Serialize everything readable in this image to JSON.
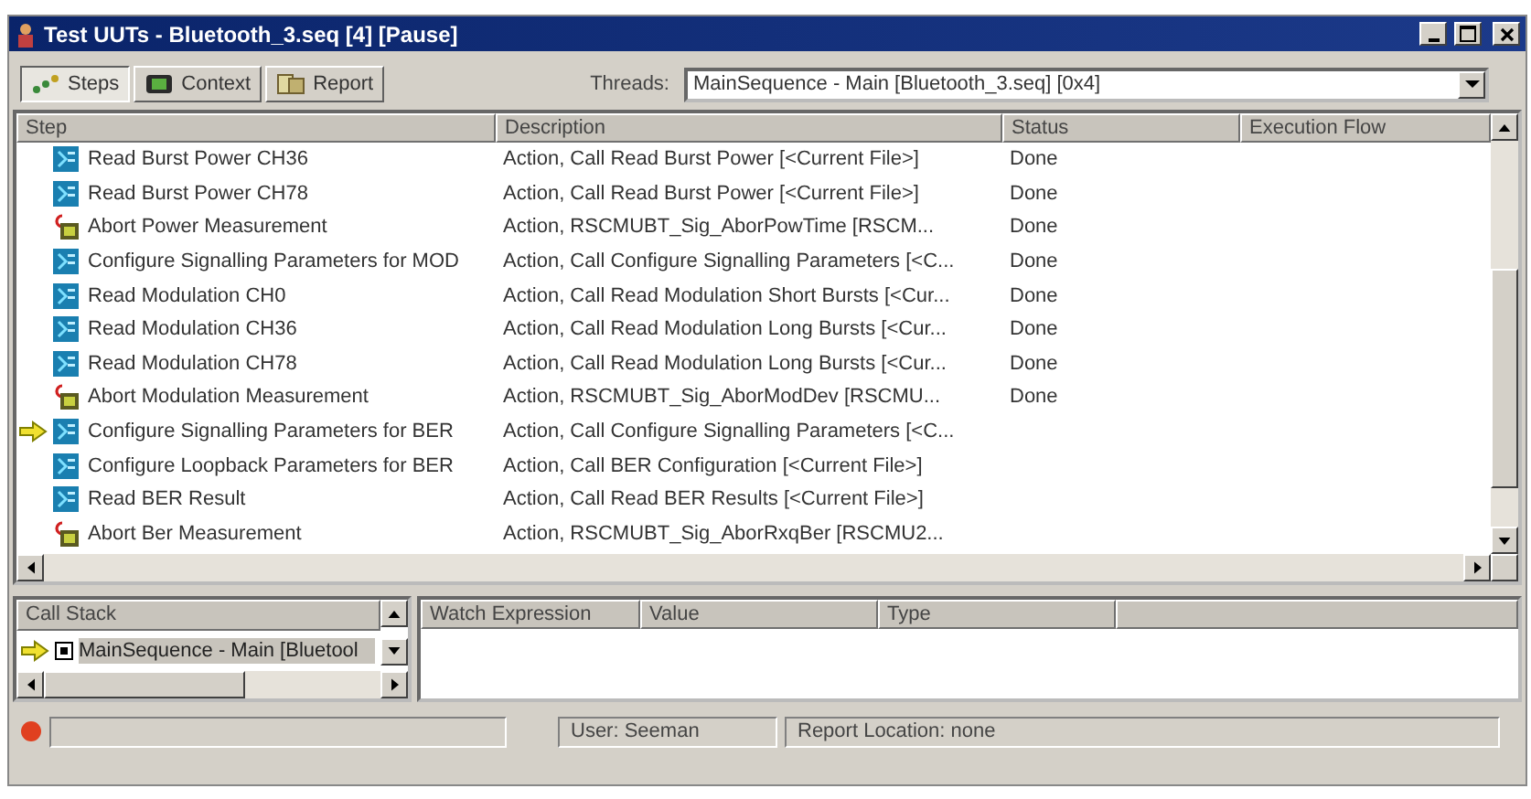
{
  "window": {
    "title": "Test UUTs - Bluetooth_3.seq [4] [Pause]"
  },
  "tabs": [
    {
      "label": "Steps",
      "selected": true
    },
    {
      "label": "Context",
      "selected": false
    },
    {
      "label": "Report",
      "selected": false
    }
  ],
  "threads": {
    "label": "Threads:",
    "value": "MainSequence - Main [Bluetooth_3.seq] [0x4]"
  },
  "steps_table": {
    "columns": [
      "Step",
      "Description",
      "Status",
      "Execution Flow"
    ],
    "rows": [
      {
        "kind": "action",
        "step": "Read Burst Power CH36",
        "description": "Action,  Call Read Burst Power [<Current File>]",
        "status": "Done",
        "current": false
      },
      {
        "kind": "action",
        "step": "Read Burst Power CH78",
        "description": "Action,  Call Read Burst Power [<Current File>]",
        "status": "Done",
        "current": false
      },
      {
        "kind": "abort",
        "step": "Abort Power Measurement",
        "description": "Action,  RSCMUBT_Sig_AborPowTime [RSCM...",
        "status": "Done",
        "current": false
      },
      {
        "kind": "action",
        "step": "Configure Signalling Parameters for MOD",
        "description": "Action,  Call Configure Signalling Parameters [<C...",
        "status": "Done",
        "current": false
      },
      {
        "kind": "action",
        "step": "Read Modulation CH0",
        "description": "Action,  Call Read Modulation Short Bursts [<Cur...",
        "status": "Done",
        "current": false
      },
      {
        "kind": "action",
        "step": "Read Modulation CH36",
        "description": "Action,  Call Read Modulation Long Bursts [<Cur...",
        "status": "Done",
        "current": false
      },
      {
        "kind": "action",
        "step": "Read Modulation CH78",
        "description": "Action,  Call Read Modulation Long Bursts [<Cur...",
        "status": "Done",
        "current": false
      },
      {
        "kind": "abort",
        "step": "Abort Modulation Measurement",
        "description": "Action,  RSCMUBT_Sig_AborModDev [RSCMU...",
        "status": "Done",
        "current": false
      },
      {
        "kind": "action",
        "step": "Configure Signalling Parameters for BER",
        "description": "Action,  Call Configure Signalling Parameters [<C...",
        "current": true
      },
      {
        "kind": "action",
        "step": "Configure Loopback Parameters for BER",
        "description": "Action,  Call BER Configuration [<Current File>]",
        "current": false
      },
      {
        "kind": "action",
        "step": "Read BER  Result",
        "description": "Action,  Call Read BER Results [<Current File>]",
        "current": false
      },
      {
        "kind": "abort",
        "step": "Abort Ber Measurement",
        "description": "Action,  RSCMUBT_Sig_AborRxqBer [RSCMU2...",
        "current": false
      }
    ]
  },
  "call_stack": {
    "header": "Call Stack",
    "items": [
      {
        "text": "MainSequence - Main [Bluetool",
        "current": true
      }
    ]
  },
  "watch": {
    "columns": [
      "Watch Expression",
      "Value",
      "Type"
    ]
  },
  "status_bar": {
    "user": "User: Seeman",
    "report_location": "Report Location: none"
  }
}
